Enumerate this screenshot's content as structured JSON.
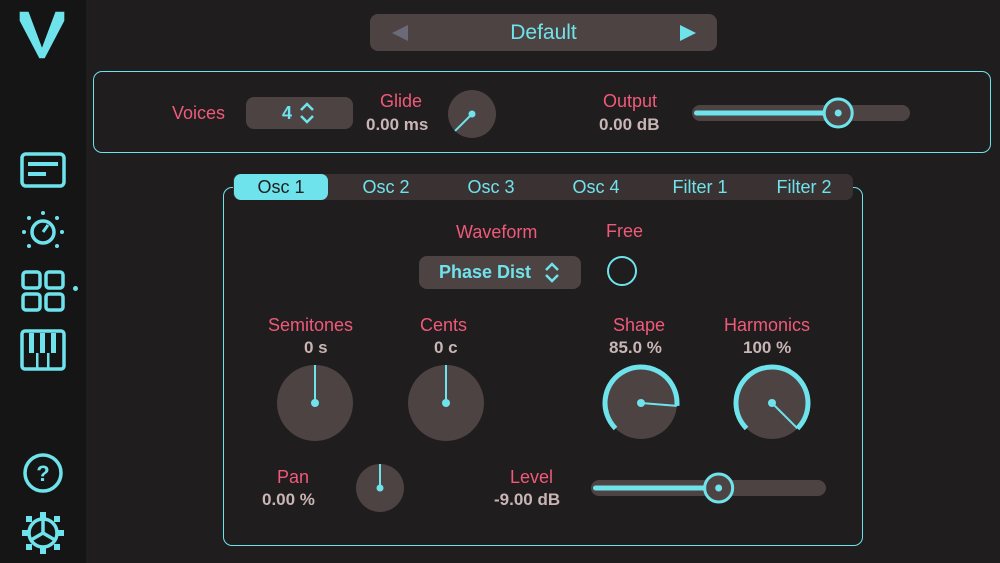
{
  "colors": {
    "accent": "#6fe3ec",
    "label": "#ef5a7a",
    "value": "#c9b5b5",
    "knob": "#4e4343"
  },
  "sidebar": {
    "items": [
      {
        "name": "logo-icon"
      },
      {
        "name": "presets-icon"
      },
      {
        "name": "effects-knob-icon"
      },
      {
        "name": "grid-icon",
        "active": true
      },
      {
        "name": "keyboard-icon"
      },
      {
        "name": "help-icon"
      },
      {
        "name": "settings-icon"
      }
    ]
  },
  "preset": {
    "name": "Default",
    "prev_icon": "triangle-left-icon",
    "next_icon": "triangle-right-icon"
  },
  "global": {
    "voices": {
      "label": "Voices",
      "value": "4"
    },
    "glide": {
      "label": "Glide",
      "value": "0.00 ms",
      "level": 0.0
    },
    "output": {
      "label": "Output",
      "value": "0.00 dB",
      "level": 0.7
    }
  },
  "tabs": [
    {
      "label": "Osc 1",
      "active": true
    },
    {
      "label": "Osc 2"
    },
    {
      "label": "Osc 3"
    },
    {
      "label": "Osc 4"
    },
    {
      "label": "Filter 1"
    },
    {
      "label": "Filter 2"
    }
  ],
  "osc": {
    "waveform": {
      "label": "Waveform",
      "value": "Phase Dist"
    },
    "free": {
      "label": "Free",
      "checked": false
    },
    "semitones": {
      "label": "Semitones",
      "value": "0 s",
      "level": 0.5
    },
    "cents": {
      "label": "Cents",
      "value": "0 c",
      "level": 0.5
    },
    "shape": {
      "label": "Shape",
      "value": "85.0 %",
      "level": 0.85
    },
    "harmonics": {
      "label": "Harmonics",
      "value": "100 %",
      "level": 1.0
    },
    "pan": {
      "label": "Pan",
      "value": "0.00 %",
      "level": 0.5
    },
    "level": {
      "label": "Level",
      "value": "-9.00 dB",
      "level": 0.55
    }
  }
}
